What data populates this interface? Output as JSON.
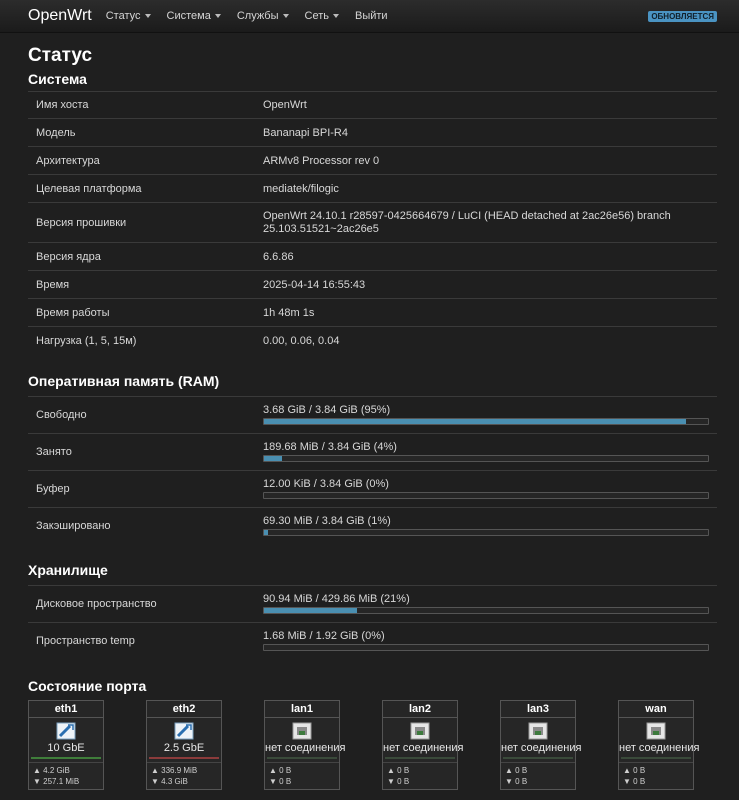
{
  "nav": {
    "brand": "OpenWrt",
    "menu": [
      "Статус",
      "Система",
      "Службы",
      "Сеть",
      "Выйти"
    ],
    "badge": "ОБНОВЛЯЕТСЯ"
  },
  "page_title": "Статус",
  "system": {
    "title": "Система",
    "rows": [
      {
        "k": "Имя хоста",
        "v": "OpenWrt"
      },
      {
        "k": "Модель",
        "v": "Bananapi BPI-R4"
      },
      {
        "k": "Архитектура",
        "v": "ARMv8 Processor rev 0"
      },
      {
        "k": "Целевая платформа",
        "v": "mediatek/filogic"
      },
      {
        "k": "Версия прошивки",
        "v": "OpenWrt 24.10.1 r28597-0425664679 / LuCI (HEAD detached at 2ac26e56) branch 25.103.51521~2ac26e5"
      },
      {
        "k": "Версия ядра",
        "v": "6.6.86"
      },
      {
        "k": "Время",
        "v": "2025-04-14 16:55:43"
      },
      {
        "k": "Время работы",
        "v": "1h 48m 1s"
      },
      {
        "k": "Нагрузка (1, 5, 15м)",
        "v": "0.00, 0.06, 0.04"
      }
    ]
  },
  "memory": {
    "title": "Оперативная память (RAM)",
    "rows": [
      {
        "k": "Свободно",
        "v": "3.68 GiB / 3.84 GiB (95%)",
        "pct": 95
      },
      {
        "k": "Занято",
        "v": "189.68 MiB / 3.84 GiB (4%)",
        "pct": 4
      },
      {
        "k": "Буфер",
        "v": "12.00 KiB / 3.84 GiB (0%)",
        "pct": 0
      },
      {
        "k": "Закэшировано",
        "v": "69.30 MiB / 3.84 GiB (1%)",
        "pct": 1
      }
    ]
  },
  "storage": {
    "title": "Хранилище",
    "rows": [
      {
        "k": "Дисковое пространство",
        "v": "90.94 MiB / 429.86 MiB (21%)",
        "pct": 21
      },
      {
        "k": "Пространство temp",
        "v": "1.68 MiB / 1.92 GiB (0%)",
        "pct": 0
      }
    ]
  },
  "ports": {
    "title": "Состояние порта",
    "items": [
      {
        "name": "eth1",
        "speed": "10 GbE",
        "connected": true,
        "line": "#3f7d3a",
        "tx": "▲ 4.2 GiB",
        "rx": "▼ 257.1 MiB"
      },
      {
        "name": "eth2",
        "speed": "2.5 GbE",
        "connected": true,
        "line": "#8b3b3b",
        "tx": "▲ 336.9 MiB",
        "rx": "▼ 4.3 GiB"
      },
      {
        "name": "lan1",
        "speed": "нет соединения",
        "connected": false,
        "line": "#3a4a3a",
        "tx": "▲ 0 B",
        "rx": "▼ 0 B"
      },
      {
        "name": "lan2",
        "speed": "нет соединения",
        "connected": false,
        "line": "#3a4a3a",
        "tx": "▲ 0 B",
        "rx": "▼ 0 B"
      },
      {
        "name": "lan3",
        "speed": "нет соединения",
        "connected": false,
        "line": "#3a4a3a",
        "tx": "▲ 0 B",
        "rx": "▼ 0 B"
      },
      {
        "name": "wan",
        "speed": "нет соединения",
        "connected": false,
        "line": "#3a4a3a",
        "tx": "▲ 0 B",
        "rx": "▼ 0 B"
      }
    ]
  }
}
